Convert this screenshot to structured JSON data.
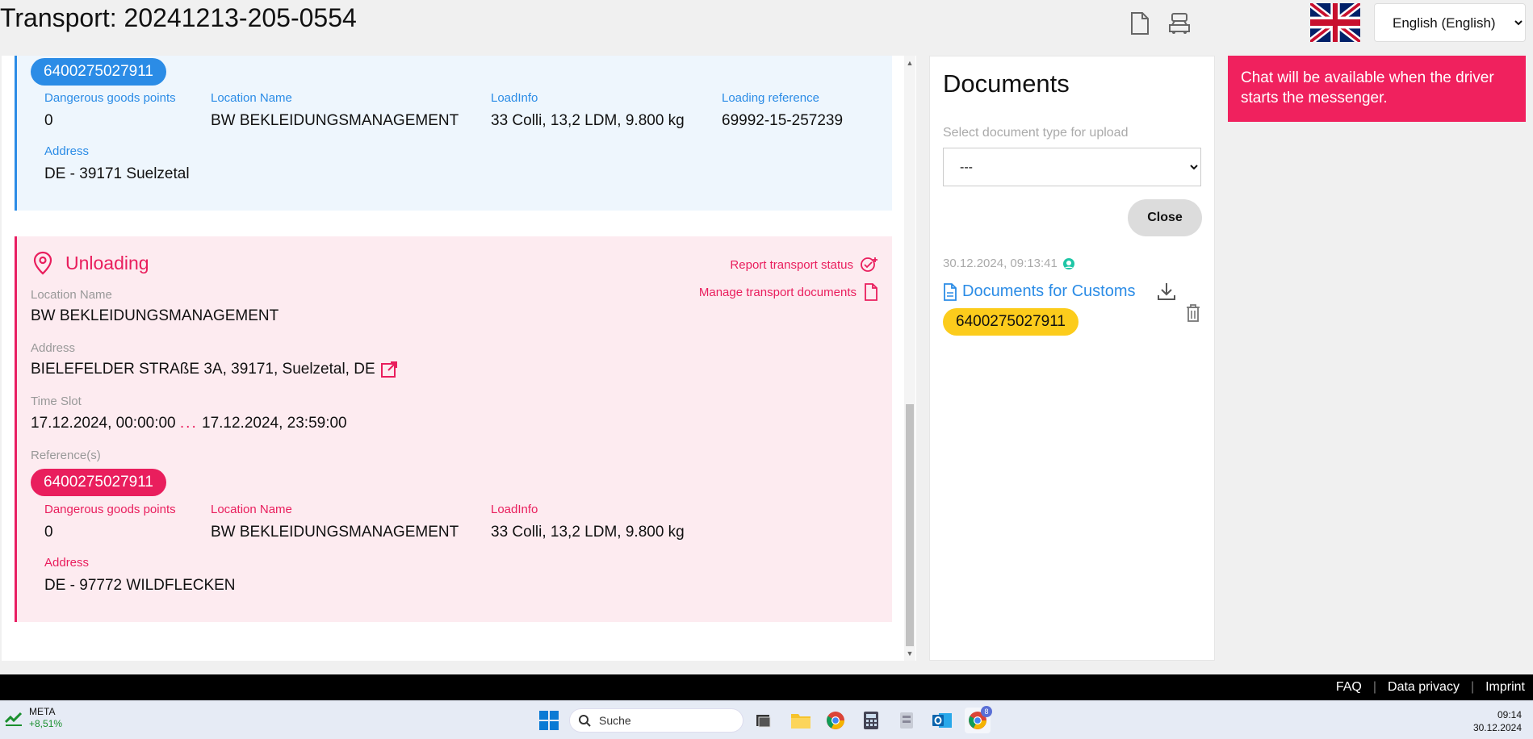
{
  "header": {
    "title": "Transport: 20241213-205-0554",
    "language_selected": "English (English)"
  },
  "loading_stop": {
    "reference": "6400275027911",
    "dangerous_goods_label": "Dangerous goods points",
    "dangerous_goods_value": "0",
    "location_name_label": "Location Name",
    "location_name_value": "BW BEKLEIDUNGSMANAGEMENT",
    "loadinfo_label": "LoadInfo",
    "loadinfo_value": "33 Colli, 13,2 LDM, 9.800 kg",
    "loading_ref_label": "Loading reference",
    "loading_ref_value": "69992-15-257239",
    "address_label": "Address",
    "address_value": "DE - 39171 Suelzetal"
  },
  "unloading_stop": {
    "title": "Unloading",
    "report_status_label": "Report transport status",
    "manage_docs_label": "Manage transport documents",
    "location_name_label": "Location Name",
    "location_name_value": "BW BEKLEIDUNGSMANAGEMENT",
    "address_label": "Address",
    "address_value": "BIELEFELDER STRAßE 3A, 39171, Suelzetal, DE",
    "time_slot_label": "Time Slot",
    "time_slot_start": "17.12.2024, 00:00:00",
    "time_slot_sep": "...",
    "time_slot_end": "17.12.2024, 23:59:00",
    "references_label": "Reference(s)",
    "reference": "6400275027911",
    "ref_detail": {
      "dangerous_goods_label": "Dangerous goods points",
      "dangerous_goods_value": "0",
      "location_name_label": "Location Name",
      "location_name_value": "BW BEKLEIDUNGSMANAGEMENT",
      "loadinfo_label": "LoadInfo",
      "loadinfo_value": "33 Colli, 13,2 LDM, 9.800 kg",
      "address_label": "Address",
      "address_value": "DE - 97772 WILDFLECKEN"
    }
  },
  "documents": {
    "title": "Documents",
    "select_label": "Select document type for upload",
    "select_value": "---",
    "close_label": "Close",
    "entry": {
      "timestamp": "30.12.2024, 09:13:41",
      "name": "Documents for Customs",
      "reference": "6400275027911"
    }
  },
  "chat": {
    "notice": "Chat will be available when the driver starts the messenger."
  },
  "footer": {
    "faq": "FAQ",
    "privacy": "Data privacy",
    "imprint": "Imprint"
  },
  "taskbar": {
    "widget_name": "META",
    "widget_change": "+8,51%",
    "search_placeholder": "Suche",
    "chrome_badge": "8",
    "time": "09:14",
    "date": "30.12.2024"
  },
  "colors": {
    "accent_blue": "#2b8ce6",
    "accent_pink": "#e91e5d",
    "reference_yellow": "#fccc1c"
  }
}
